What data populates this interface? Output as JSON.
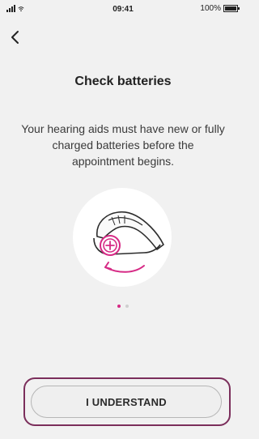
{
  "status_bar": {
    "time": "09:41",
    "battery_percent": "100%",
    "battery_level": 1.0
  },
  "screen": {
    "title": "Check batteries",
    "description": "Your hearing aids must have new or fully charged batteries before the appointment begins."
  },
  "pager": {
    "total": 2,
    "active_index": 0
  },
  "actions": {
    "confirm_label": "I UNDERSTAND"
  },
  "colors": {
    "accent": "#d62a85",
    "frame": "#7b2e5b",
    "background": "#f1f1f1"
  },
  "icons": {
    "back": "chevron-left-icon",
    "signal": "signal-icon",
    "wifi": "wifi-icon",
    "battery": "battery-icon",
    "illustration": "hearing-aid-battery-illustration"
  }
}
